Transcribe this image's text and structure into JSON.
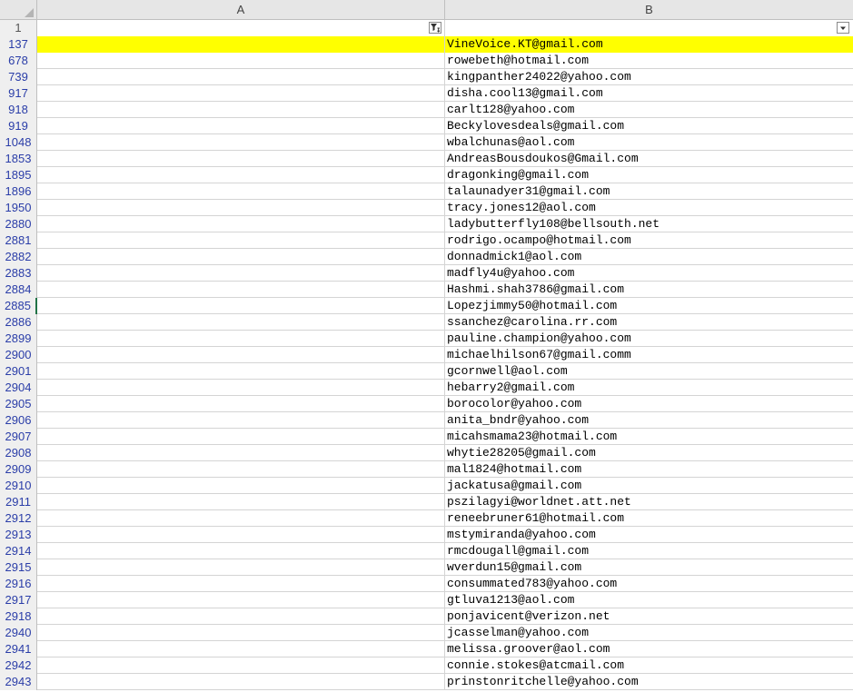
{
  "columns": [
    {
      "letter": "A"
    },
    {
      "letter": "B"
    }
  ],
  "header_row_number": "1",
  "icons": {
    "filter_active": "filter-funnel-sort-icon",
    "filter_dropdown": "dropdown-arrow-icon"
  },
  "highlight_color": "#ffff00",
  "rows": [
    {
      "num": "137",
      "email": "VineVoice.KT@gmail.com"
    },
    {
      "num": "678",
      "email": "rowebeth@hotmail.com"
    },
    {
      "num": "739",
      "email": "kingpanther24022@yahoo.com"
    },
    {
      "num": "917",
      "email": "disha.cool13@gmail.com"
    },
    {
      "num": "918",
      "email": "carlt128@yahoo.com"
    },
    {
      "num": "919",
      "email": "Beckylovesdeals@gmail.com"
    },
    {
      "num": "1048",
      "email": "wbalchunas@aol.com"
    },
    {
      "num": "1853",
      "email": "AndreasBousdoukos@Gmail.com"
    },
    {
      "num": "1895",
      "email": "dragonking@gmail.com"
    },
    {
      "num": "1896",
      "email": "talaunadyer31@gmail.com"
    },
    {
      "num": "1950",
      "email": "tracy.jones12@aol.com"
    },
    {
      "num": "2880",
      "email": "ladybutterfly108@bellsouth.net"
    },
    {
      "num": "2881",
      "email": "rodrigo.ocampo@hotmail.com"
    },
    {
      "num": "2882",
      "email": "donnadmick1@aol.com"
    },
    {
      "num": "2883",
      "email": "madfly4u@yahoo.com"
    },
    {
      "num": "2884",
      "email": "Hashmi.shah3786@gmail.com"
    },
    {
      "num": "2885",
      "email": "Lopezjimmy50@hotmail.com"
    },
    {
      "num": "2886",
      "email": "ssanchez@carolina.rr.com"
    },
    {
      "num": "2899",
      "email": "pauline.champion@yahoo.com"
    },
    {
      "num": "2900",
      "email": "michaelhilson67@gmail.comm"
    },
    {
      "num": "2901",
      "email": "gcornwell@aol.com"
    },
    {
      "num": "2904",
      "email": "hebarry2@gmail.com"
    },
    {
      "num": "2905",
      "email": "borocolor@yahoo.com"
    },
    {
      "num": "2906",
      "email": "anita_bndr@yahoo.com"
    },
    {
      "num": "2907",
      "email": "micahsmama23@hotmail.com"
    },
    {
      "num": "2908",
      "email": "whytie28205@gmail.com"
    },
    {
      "num": "2909",
      "email": "mal1824@hotmail.com"
    },
    {
      "num": "2910",
      "email": "jackatusa@gmail.com"
    },
    {
      "num": "2911",
      "email": "pszilagyi@worldnet.att.net"
    },
    {
      "num": "2912",
      "email": "reneebruner61@hotmail.com"
    },
    {
      "num": "2913",
      "email": "mstymiranda@yahoo.com"
    },
    {
      "num": "2914",
      "email": "rmcdougall@gmail.com"
    },
    {
      "num": "2915",
      "email": "wverdun15@gmail.com"
    },
    {
      "num": "2916",
      "email": "consummated783@yahoo.com"
    },
    {
      "num": "2917",
      "email": "gtluva1213@aol.com"
    },
    {
      "num": "2918",
      "email": "ponjavicent@verizon.net"
    },
    {
      "num": "2940",
      "email": "jcasselman@yahoo.com"
    },
    {
      "num": "2941",
      "email": "melissa.groover@aol.com"
    },
    {
      "num": "2942",
      "email": "connie.stokes@atcmail.com"
    },
    {
      "num": "2943",
      "email": "prinstonritchelle@yahoo.com"
    }
  ]
}
